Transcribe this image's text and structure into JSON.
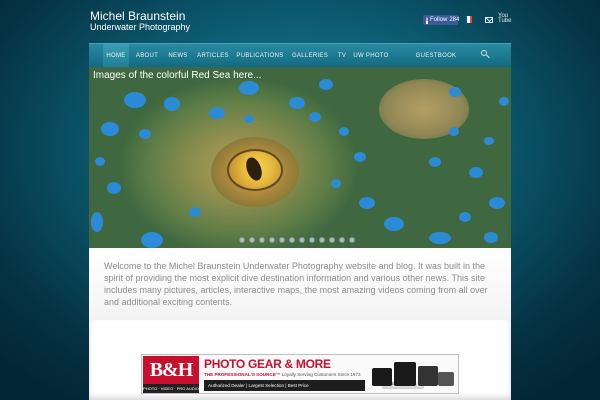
{
  "site": {
    "title": "Michel Braunstein",
    "subtitle": "Underwater Photography"
  },
  "header_icons": {
    "facebook_label": "Follow",
    "facebook_count": "284",
    "flag_colors": [
      "#0055a4",
      "#ffffff",
      "#ef4135"
    ],
    "mail_icon": "mail-icon",
    "youtube_icon": "youtube-icon"
  },
  "nav": {
    "items": [
      {
        "label": "HOME",
        "active": true
      },
      {
        "label": "ABOUT",
        "active": false
      },
      {
        "label": "NEWS",
        "active": false
      },
      {
        "label": "ARTICLES",
        "active": false
      },
      {
        "label": "PUBLICATIONS",
        "active": false
      },
      {
        "label": "GALLERIES",
        "active": false
      },
      {
        "label": "TV",
        "active": false
      },
      {
        "label": "UW PHOTO",
        "active": false
      },
      {
        "label": "GUESTBOOK",
        "active": false
      }
    ],
    "search_icon": "search-icon"
  },
  "hero": {
    "caption": "Images of the colorful Red Sea here...",
    "slide_count": 12,
    "dot_color": "#2c8bd6"
  },
  "welcome": {
    "text": "Welcome to the Michel Braunstein Underwater Photography website and blog. It was built in the spirit of providing the most explicit dive destination information and various other news. This site includes many pictures, articles, interactive maps, the most amazing videos coming from all over and additional exciting contents."
  },
  "banner": {
    "logo": "B&H",
    "logo_sub": "PHOTO · VIDEO · PRO AUDIO",
    "headline": "PHOTO GEAR & MORE",
    "tagline_brand": "THE PROFESSIONAL'S SOURCE™",
    "tagline_rest": " Loyally Serving Customers Since 1973",
    "bar_text": "Authorized Dealer | Largest Selection | Best Price",
    "shop_button": "Shop Now ›",
    "brand_color": "#c8102e"
  }
}
